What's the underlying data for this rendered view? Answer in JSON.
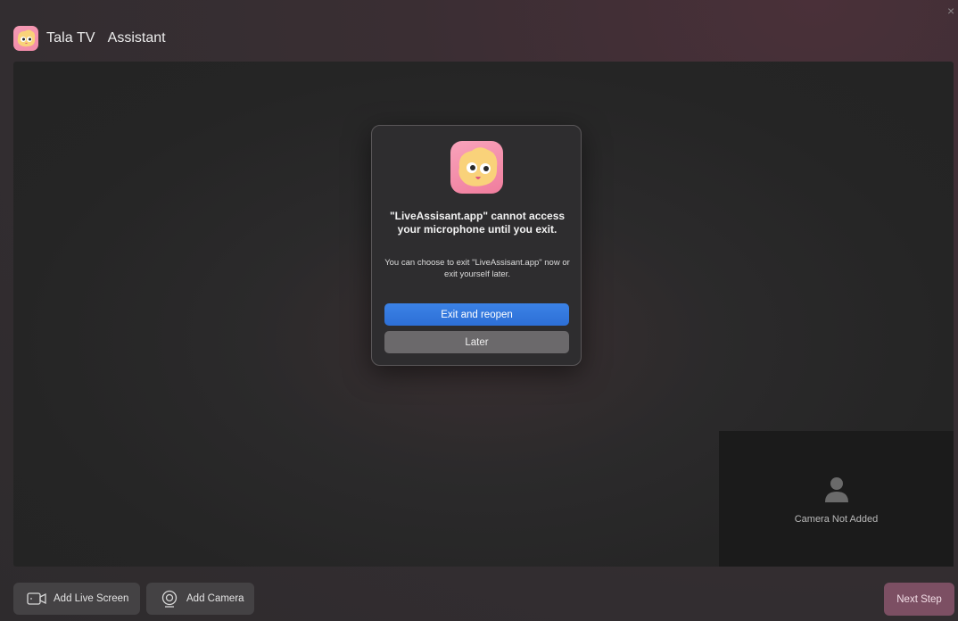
{
  "window": {
    "close_glyph": "×"
  },
  "header": {
    "app_name": "Tala TV",
    "subtitle": "Assistant",
    "logo_icon": "tala-mascot-logo"
  },
  "camera_preview": {
    "status_text": "Camera Not Added",
    "icon": "person-icon"
  },
  "toolbar": {
    "add_live_screen_label": "Add Live Screen",
    "add_camera_label": "Add Camera",
    "next_step_label": "Next Step"
  },
  "dialog": {
    "title": "\"LiveAssisant.app\" cannot access your microphone until you exit.",
    "message": "You can choose to exit \"LiveAssisant.app\" now or exit yourself later.",
    "primary_button": "Exit and reopen",
    "secondary_button": "Later"
  },
  "colors": {
    "primary_button": "#2d6fd6",
    "next_step_button": "#7c4f63",
    "logo_pink": "#f28aa8"
  }
}
